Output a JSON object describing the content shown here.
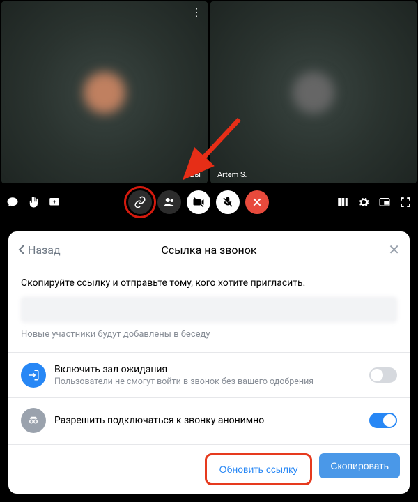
{
  "call": {
    "participant1_label": "Вы",
    "participant2_label": "Artem S."
  },
  "sheet": {
    "back_label": "Назад",
    "title": "Ссылка на звонок",
    "instruction": "Скопируйте ссылку и отправьте тому, кого хотите пригласить.",
    "hint": "Новые участники будут добавлены в беседу",
    "option1": {
      "title": "Включить зал ожидания",
      "subtitle": "Пользователи не смогут войти в звонок без вашего одобрения"
    },
    "option2": {
      "title": "Разрешить подключаться к звонку анонимно"
    },
    "update_label": "Обновить ссылку",
    "copy_label": "Скопировать"
  }
}
